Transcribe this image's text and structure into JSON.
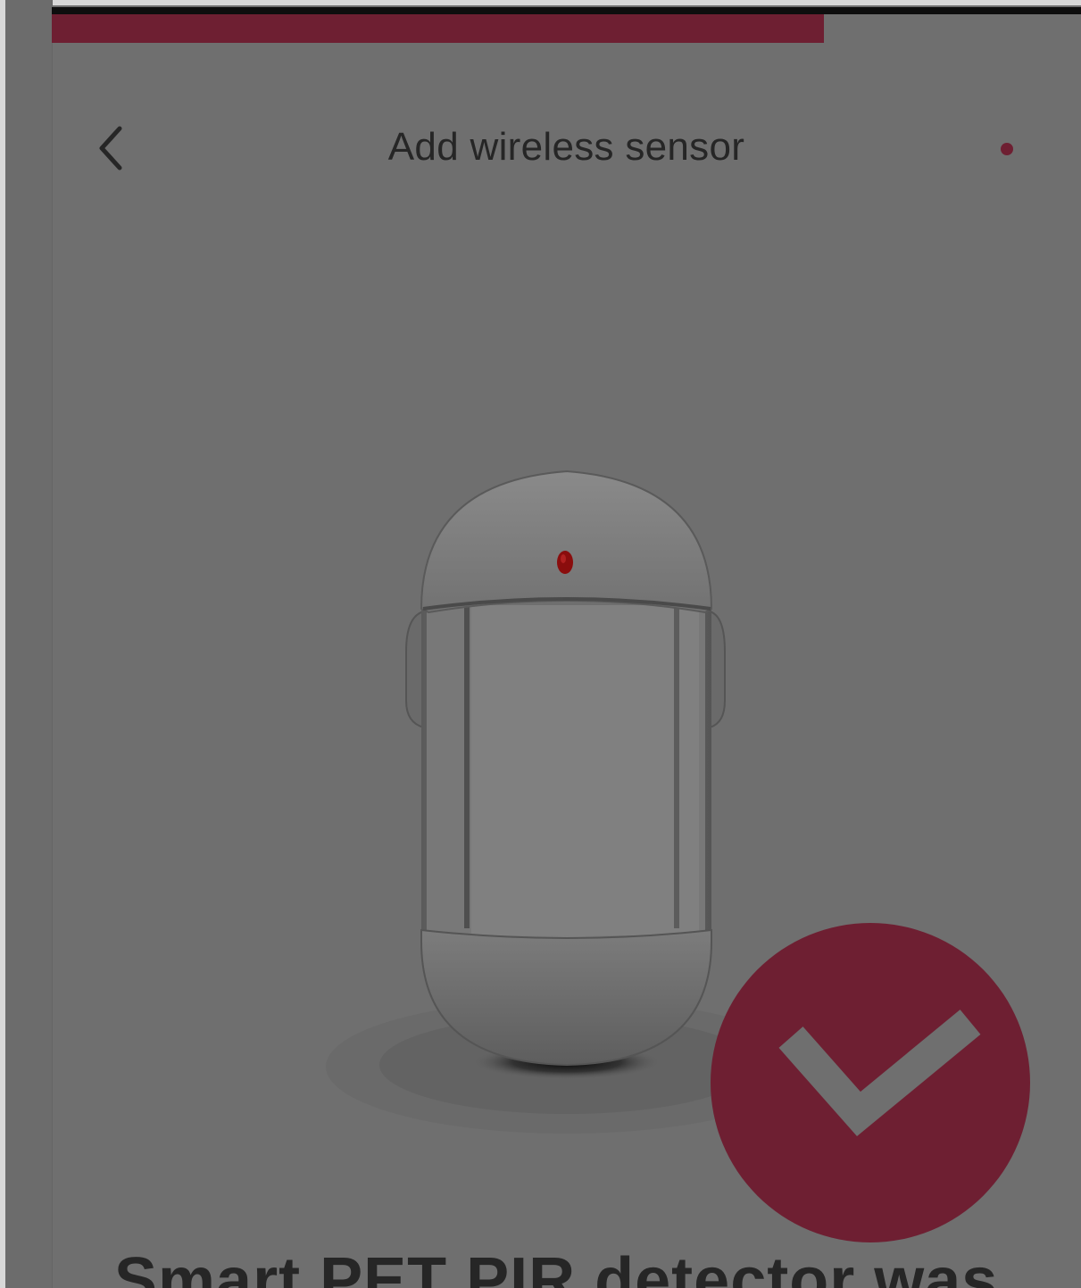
{
  "progress": {
    "fraction": 0.75,
    "color": "#6e1f32"
  },
  "header": {
    "title": "Add wireless sensor",
    "back_icon": "chevron-left-icon",
    "status_dot_color": "#6e1f32"
  },
  "device": {
    "image": "pir-motion-sensor-image"
  },
  "success": {
    "icon": "checkmark-icon",
    "color": "#6e1f32"
  },
  "product": {
    "name": "Smart PET PIR detector was"
  }
}
